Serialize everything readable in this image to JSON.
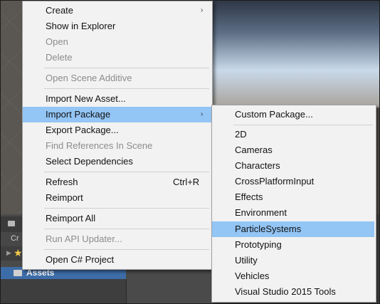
{
  "context_menu": {
    "items": [
      {
        "label": "Create",
        "disabled": false,
        "submenu": true
      },
      {
        "label": "Show in Explorer",
        "disabled": false
      },
      {
        "label": "Open",
        "disabled": true
      },
      {
        "label": "Delete",
        "disabled": true
      },
      {
        "label": "Open Scene Additive",
        "disabled": true
      },
      {
        "label": "Import New Asset...",
        "disabled": false
      },
      {
        "label": "Import Package",
        "disabled": false,
        "submenu": true,
        "highlighted": true
      },
      {
        "label": "Export Package...",
        "disabled": false
      },
      {
        "label": "Find References In Scene",
        "disabled": true
      },
      {
        "label": "Select Dependencies",
        "disabled": false
      },
      {
        "label": "Refresh",
        "disabled": false,
        "shortcut": "Ctrl+R"
      },
      {
        "label": "Reimport",
        "disabled": false
      },
      {
        "label": "Reimport All",
        "disabled": false
      },
      {
        "label": "Run API Updater...",
        "disabled": true
      },
      {
        "label": "Open C# Project",
        "disabled": false
      }
    ],
    "submenu_arrow": "›"
  },
  "import_package_submenu": {
    "items": [
      {
        "label": "Custom Package..."
      },
      {
        "label": "2D"
      },
      {
        "label": "Cameras"
      },
      {
        "label": "Characters"
      },
      {
        "label": "CrossPlatformInput"
      },
      {
        "label": "Effects"
      },
      {
        "label": "Environment"
      },
      {
        "label": "ParticleSystems",
        "highlighted": true
      },
      {
        "label": "Prototyping"
      },
      {
        "label": "Utility"
      },
      {
        "label": "Vehicles"
      },
      {
        "label": "Visual Studio 2015 Tools"
      }
    ]
  },
  "project_panel": {
    "partial_tab_text": "Cr",
    "assets_label": "Assets"
  },
  "colors": {
    "highlight": "#93c5f5",
    "menu_bg": "#f2f2f2",
    "disabled_text": "#8c8c8c",
    "assets_selection": "#3d6da8"
  }
}
